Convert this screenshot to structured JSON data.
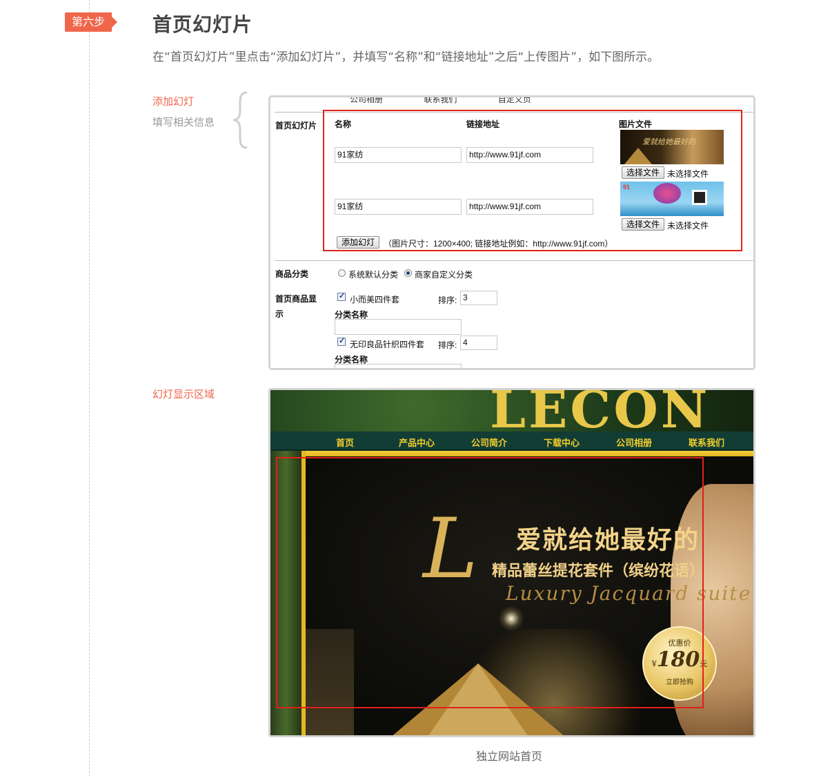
{
  "step": {
    "badge": "第六步",
    "title": "首页幻灯片",
    "description": "在“首页幻灯片”里点击“添加幻灯片”，并填写“名称”和“链接地址”之后“上传图片”，如下图所示。"
  },
  "side_labels": {
    "add_slide": "添加幻灯",
    "fill_info": "填写相关信息",
    "display_area": "幻灯显示区域"
  },
  "form": {
    "cut_top_items": [
      "公司相册",
      "联系我们",
      "自定义页"
    ],
    "slides_label": "首页幻灯片",
    "columns": {
      "name": "名称",
      "link": "链接地址",
      "image": "图片文件"
    },
    "slides": [
      {
        "name": "91家纺",
        "link": "http://www.91jf.com",
        "file_button": "选择文件",
        "file_status": "未选择文件"
      },
      {
        "name": "91家纺",
        "link": "http://www.91jf.com",
        "file_button": "选择文件",
        "file_status": "未选择文件"
      }
    ],
    "add_button": "添加幻灯",
    "hint": "（图片尺寸：1200×400; 链接地址例如：http://www.91jf.com）",
    "category_label": "商品分类",
    "category_options": [
      "系统默认分类",
      "商家自定义分类"
    ],
    "category_selected": "商家自定义分类",
    "homepage_goods_label": "首页商品显",
    "homepage_goods_label2": "示",
    "goods": [
      {
        "name": "小而美四件套",
        "checked": true,
        "sort_label": "排序:",
        "sort": "3",
        "category_name_label": "分类名称"
      },
      {
        "name": "无印良品针织四件套",
        "checked": true,
        "sort_label": "排序:",
        "sort": "4",
        "category_name_label": "分类名称"
      }
    ],
    "thumb1_text": "爱就给她最好的"
  },
  "banner": {
    "logo_text": "LECON",
    "nav": [
      "首页",
      "产品中心",
      "公司简介",
      "下载中心",
      "公司相册",
      "联系我们"
    ],
    "headline": "爱就给她最好的",
    "subheadline": "精品蕾丝提花套件（缤纷花语）",
    "script_text": "Luxury Jacquard suite",
    "script_letter": "L",
    "badge_line1": "优惠价",
    "badge_currency": "¥",
    "badge_price": "180",
    "badge_unit": "元",
    "badge_line3": "立即抢购"
  },
  "caption": "独立网站首页",
  "colors": {
    "accent": "#f0664a",
    "highlight_red": "#e0201a",
    "nav_gold": "#f3cf2b",
    "nav_bg": "#123d35"
  }
}
